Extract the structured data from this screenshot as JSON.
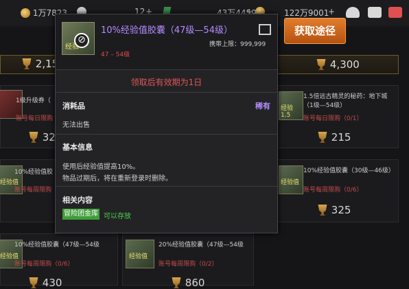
{
  "topbar": {
    "gold_amount": "1万7823",
    "currency2_amount": "12",
    "currency3_amount": "43万4459",
    "currency4_amount": "122万9001",
    "plus": "+"
  },
  "acquire_button": "获取途径",
  "grid": {
    "price_bars": [
      "2,15",
      "4,300"
    ],
    "cells": [
      {
        "title": "1级升级券（",
        "limit": "账号每日限购（1/1",
        "price": "32",
        "thumb": "级"
      },
      {
        "title": "1.5倍远古精灵的秘药：地下城（1级—54级）",
        "limit": "账号每日限购（0/1）",
        "price": "215",
        "thumb": "经验1.5"
      },
      {
        "title": "10%经验值胶",
        "limit": "账号每周限购",
        "price": "",
        "thumb": "经验值"
      },
      {
        "title": "10%经验值胶囊（30级—46级）",
        "limit": "账号每周限购（0/6）",
        "price": "325",
        "thumb": "经验值"
      },
      {
        "title": "10%经验值胶囊（47级—54级",
        "limit": "账号每周限购（0/6）",
        "price": "430",
        "thumb": "经验值"
      },
      {
        "title": "20%经验值胶囊（47级—54级",
        "limit": "账号每周限购（0/2）",
        "price": "860",
        "thumb": "经验值"
      }
    ]
  },
  "tooltip": {
    "title": "10%经验值胶囊（47级—54级）",
    "carry_limit": "携带上限：999,999",
    "level_range": "47 – 54级",
    "validity": "领取后有效期为1日",
    "category": "消耗品",
    "rarity": "稀有",
    "cannot_sell": "无法出售",
    "basic_info_title": "基本信息",
    "basic_info_line1": "使用后经验值提高10%。",
    "basic_info_line2": "物品过期后，将在重新登录时删除。",
    "related_title": "相关内容",
    "related_tag": "冒险团金库",
    "related_text": "可以存放",
    "icon_text": "经验"
  },
  "colors": {
    "rare": "#b38cff",
    "warning": "#e25656",
    "accent": "#d0671d",
    "green": "#4cd24c"
  }
}
